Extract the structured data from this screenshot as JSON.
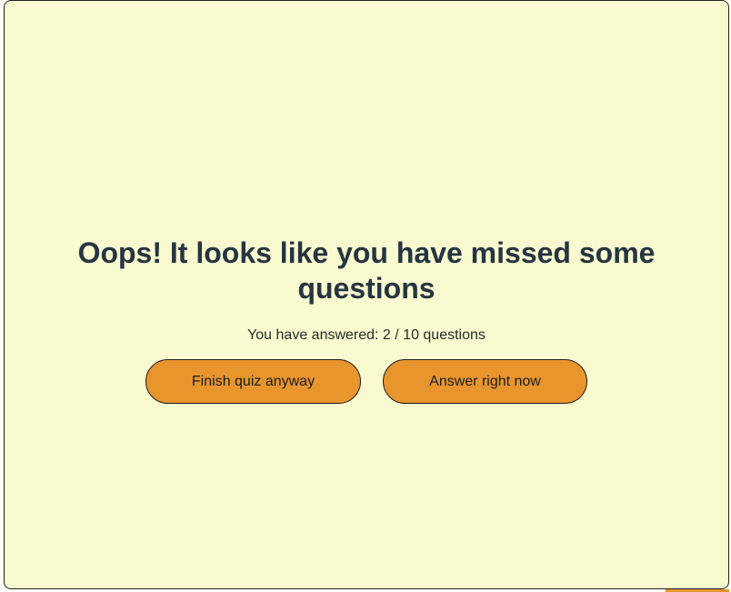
{
  "dialog": {
    "title": "Oops! It looks like you have missed some questions",
    "answered_text": "You have answered: 2 / 10 questions",
    "finish_button_label": "Finish quiz anyway",
    "answer_button_label": "Answer right now"
  },
  "colors": {
    "background": "#f9fad0",
    "button_fill": "#e8952d",
    "title_text": "#263540"
  }
}
